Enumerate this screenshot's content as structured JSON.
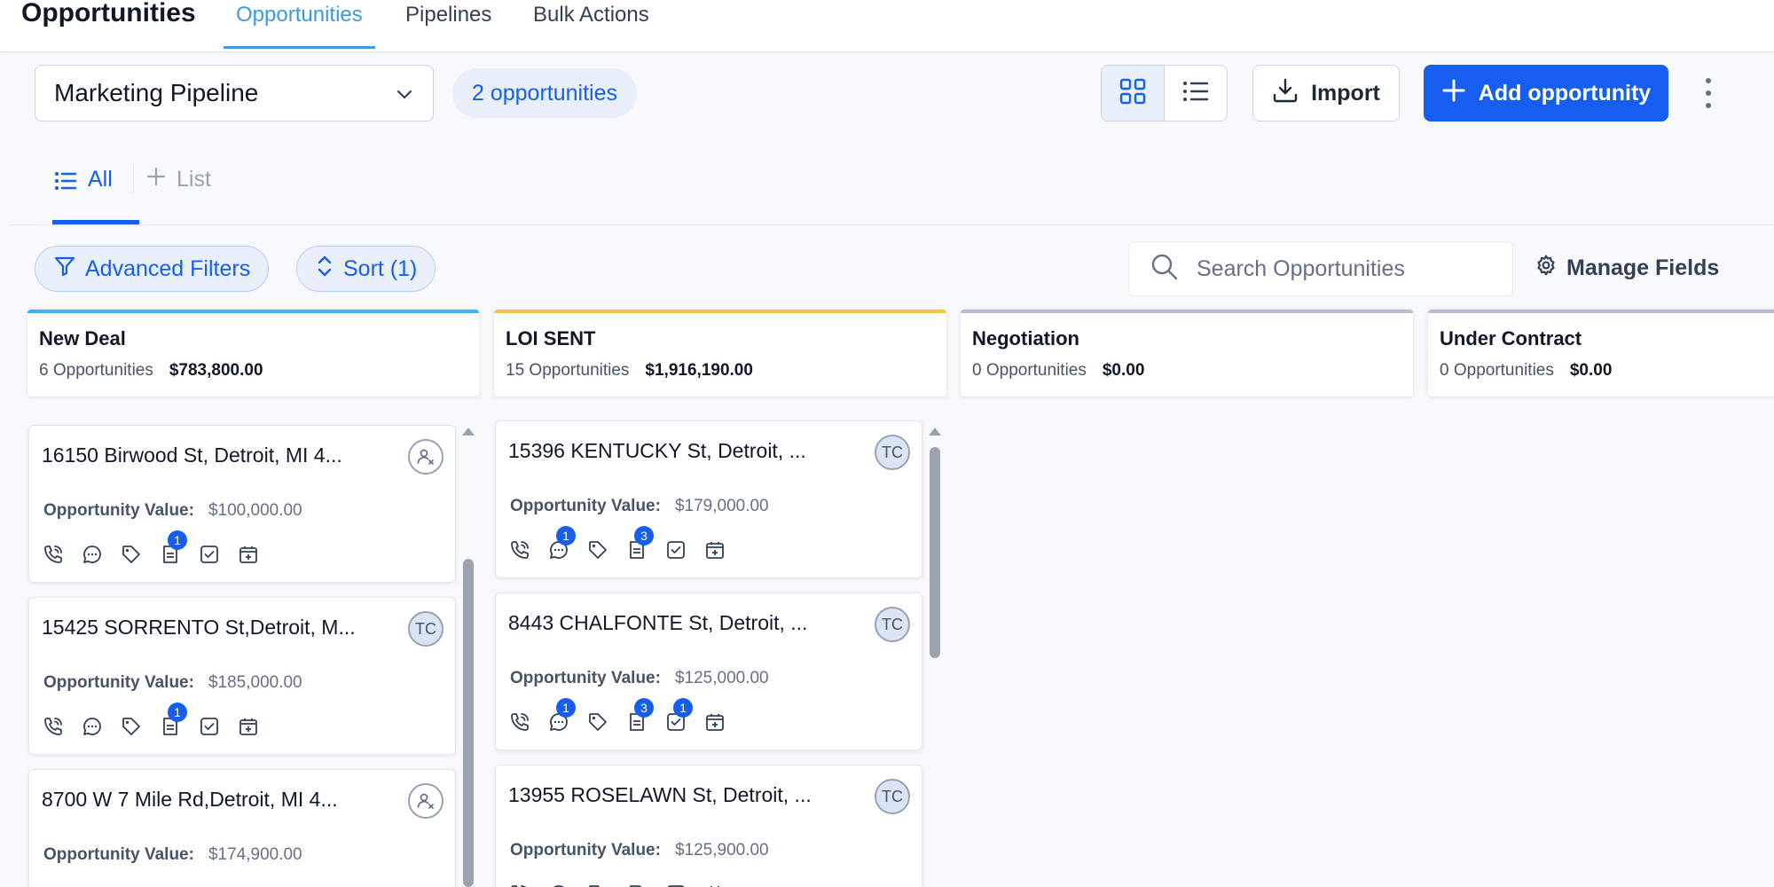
{
  "header": {
    "title": "Opportunities",
    "tabs": [
      {
        "label": "Opportunities"
      },
      {
        "label": "Pipelines"
      },
      {
        "label": "Bulk Actions"
      }
    ]
  },
  "toolbar": {
    "pipeline": "Marketing Pipeline",
    "count_label": "2 opportunities",
    "import_label": "Import",
    "add_label": "Add opportunity"
  },
  "list_tabs": {
    "all_label": "All",
    "add_list_label": "List"
  },
  "filters": {
    "advanced_label": "Advanced Filters",
    "sort_label": "Sort (1)",
    "search_placeholder": "Search Opportunities",
    "manage_fields_label": "Manage Fields"
  },
  "colors": {
    "accent": "#155eef",
    "new_deal": "#3bb3f0",
    "loi_sent": "#f5c542",
    "negotiation": "#b6bdd6",
    "under_contract": "#b6bdd6"
  },
  "columns": [
    {
      "title": "New Deal",
      "count": "6 Opportunities",
      "value": "$783,800.00",
      "cards": [
        {
          "title": "16150 Birwood St, Detroit, MI 4...",
          "avatar": "",
          "value_label": "Opportunity Value:",
          "value": "$100,000.00",
          "badges": {
            "notes": "1"
          }
        },
        {
          "title": "15425 SORRENTO St,Detroit, M...",
          "avatar": "TC",
          "value_label": "Opportunity Value:",
          "value": "$185,000.00",
          "badges": {
            "notes": "1"
          }
        },
        {
          "title": "8700 W 7 Mile Rd,Detroit, MI 4...",
          "avatar": "",
          "value_label": "Opportunity Value:",
          "value": "$174,900.00",
          "badges": {}
        }
      ]
    },
    {
      "title": "LOI SENT",
      "count": "15 Opportunities",
      "value": "$1,916,190.00",
      "cards": [
        {
          "title": "15396 KENTUCKY St, Detroit, ...",
          "avatar": "TC",
          "value_label": "Opportunity Value:",
          "value": "$179,000.00",
          "badges": {
            "sms": "1",
            "notes": "3"
          }
        },
        {
          "title": "8443 CHALFONTE St, Detroit, ...",
          "avatar": "TC",
          "value_label": "Opportunity Value:",
          "value": "$125,000.00",
          "badges": {
            "sms": "1",
            "notes": "3",
            "tasks": "1"
          }
        },
        {
          "title": "13955 ROSELAWN St, Detroit, ...",
          "avatar": "TC",
          "value_label": "Opportunity Value:",
          "value": "$125,900.00",
          "badges": {}
        }
      ]
    },
    {
      "title": "Negotiation",
      "count": "0 Opportunities",
      "value": "$0.00",
      "cards": []
    },
    {
      "title": "Under Contract",
      "count": "0 Opportunities",
      "value": "$0.00",
      "cards": []
    }
  ]
}
